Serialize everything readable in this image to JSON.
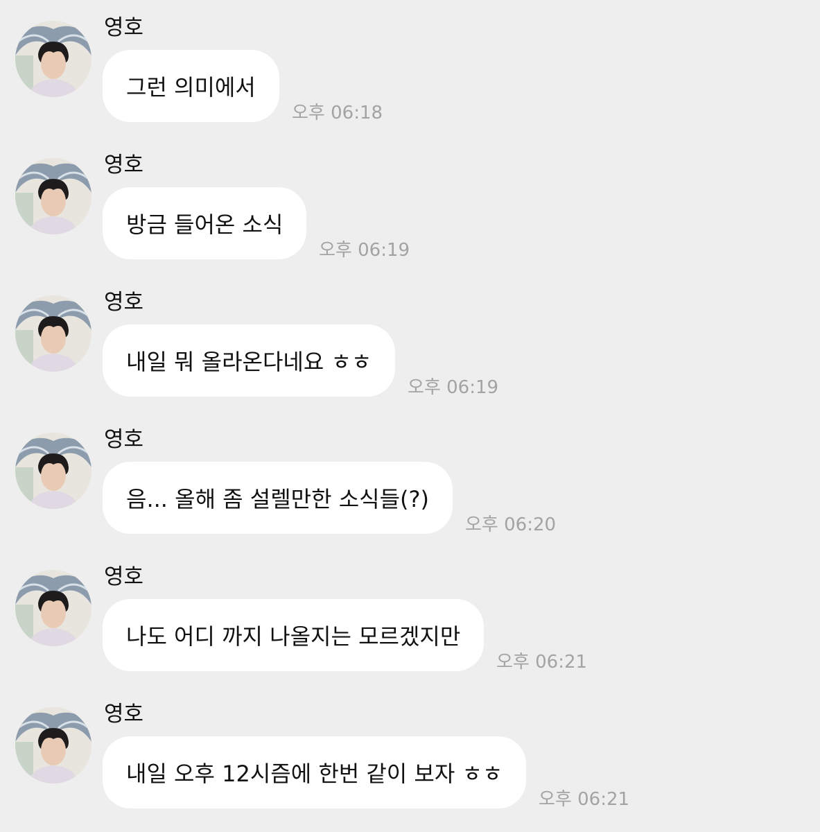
{
  "messages": [
    {
      "sender": "영호",
      "text": "그런 의미에서",
      "time": "오후 06:18"
    },
    {
      "sender": "영호",
      "text": "방금 들어온 소식",
      "time": "오후 06:19"
    },
    {
      "sender": "영호",
      "text": "내일 뭐 올라온다네요 ㅎㅎ",
      "time": "오후 06:19"
    },
    {
      "sender": "영호",
      "text": "음... 올해 좀 설렐만한 소식들(?)",
      "time": "오후 06:20"
    },
    {
      "sender": "영호",
      "text": "나도 어디 까지 나올지는 모르겠지만",
      "time": "오후 06:21"
    },
    {
      "sender": "영호",
      "text": "내일 오후 12시즘에 한번 같이 보자 ㅎㅎ",
      "time": "오후 06:21"
    }
  ],
  "avatar_icon": "profile-photo",
  "colors": {
    "background": "#eeeeee",
    "bubble": "#ffffff",
    "timestamp": "#a3a3a3",
    "text": "#111111"
  }
}
